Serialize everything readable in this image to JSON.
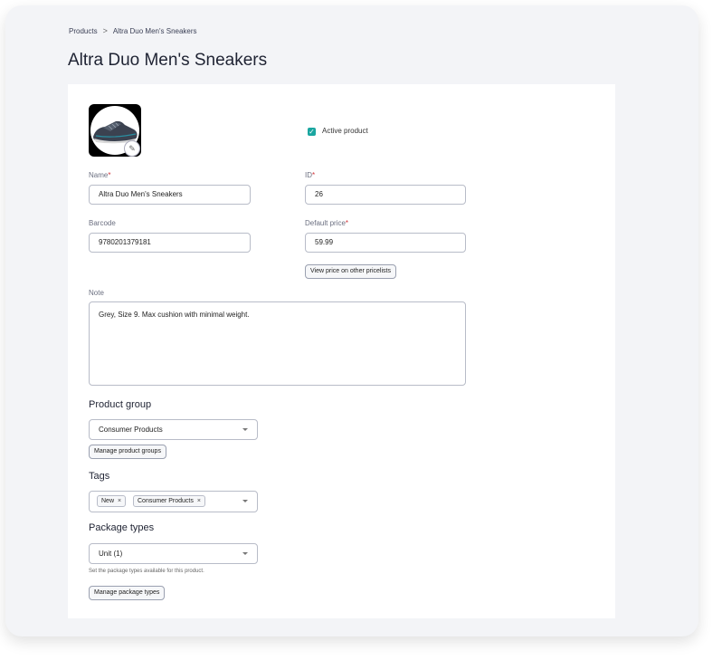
{
  "breadcrumb": {
    "root": "Products",
    "separator": ">",
    "current": "Altra Duo Men's Sneakers"
  },
  "title": "Altra Duo Men's Sneakers",
  "product_image": {
    "edit_icon": "pencil-icon"
  },
  "active": {
    "label": "Active product",
    "checked": true
  },
  "fields": {
    "name": {
      "label": "Name",
      "required": "*",
      "value": "Altra Duo Men's Sneakers"
    },
    "id": {
      "label": "ID",
      "required": "*",
      "value": "26"
    },
    "barcode": {
      "label": "Barcode",
      "value": "9780201379181"
    },
    "default_price": {
      "label": "Default price",
      "required": "*",
      "value": "59.99"
    },
    "view_price_button": "View price on other pricelists",
    "note": {
      "label": "Note",
      "value": "Grey, Size 9. Max cushion with minimal weight."
    }
  },
  "product_group": {
    "heading": "Product group",
    "value": "Consumer Products",
    "manage_button": "Manage product groups"
  },
  "tags": {
    "heading": "Tags",
    "items": [
      "New",
      "Consumer Products"
    ],
    "remove_glyph": "×"
  },
  "package_types": {
    "heading": "Package types",
    "value": "Unit (1)",
    "hint": "Set the package types available for this product.",
    "manage_button": "Manage package types"
  },
  "colors": {
    "accent": "#1aa6a0",
    "required": "#d0353b"
  }
}
